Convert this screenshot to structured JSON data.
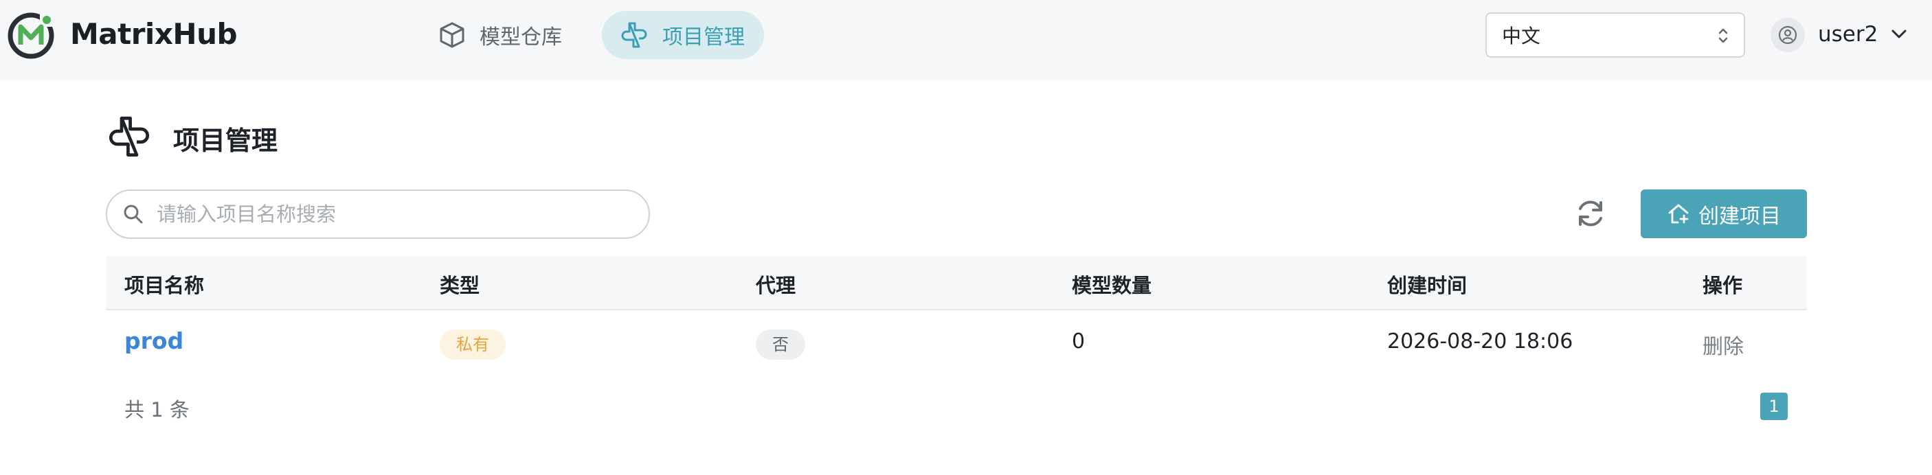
{
  "header": {
    "brand": "MatrixHub",
    "nav": [
      {
        "label": "模型仓库",
        "icon": "cube-icon",
        "active": false
      },
      {
        "label": "项目管理",
        "icon": "project-icon",
        "active": true
      }
    ],
    "language": "中文",
    "user": "user2"
  },
  "page": {
    "title": "项目管理",
    "search_placeholder": "请输入项目名称搜索",
    "create_label": "创建项目"
  },
  "table": {
    "columns": [
      "项目名称",
      "类型",
      "代理",
      "模型数量",
      "创建时间",
      "操作"
    ],
    "rows": [
      {
        "name": "prod",
        "type": "私有",
        "proxy": "否",
        "model_count": "0",
        "created": "2026-08-20 18:06",
        "action": "删除"
      }
    ]
  },
  "pagination": {
    "total": "共 1 条",
    "page": "1"
  },
  "colors": {
    "accent": "#4ba3b8",
    "link": "#3b86d9",
    "logo_green": "#4fae57",
    "private_tag": "#e8a33d"
  }
}
